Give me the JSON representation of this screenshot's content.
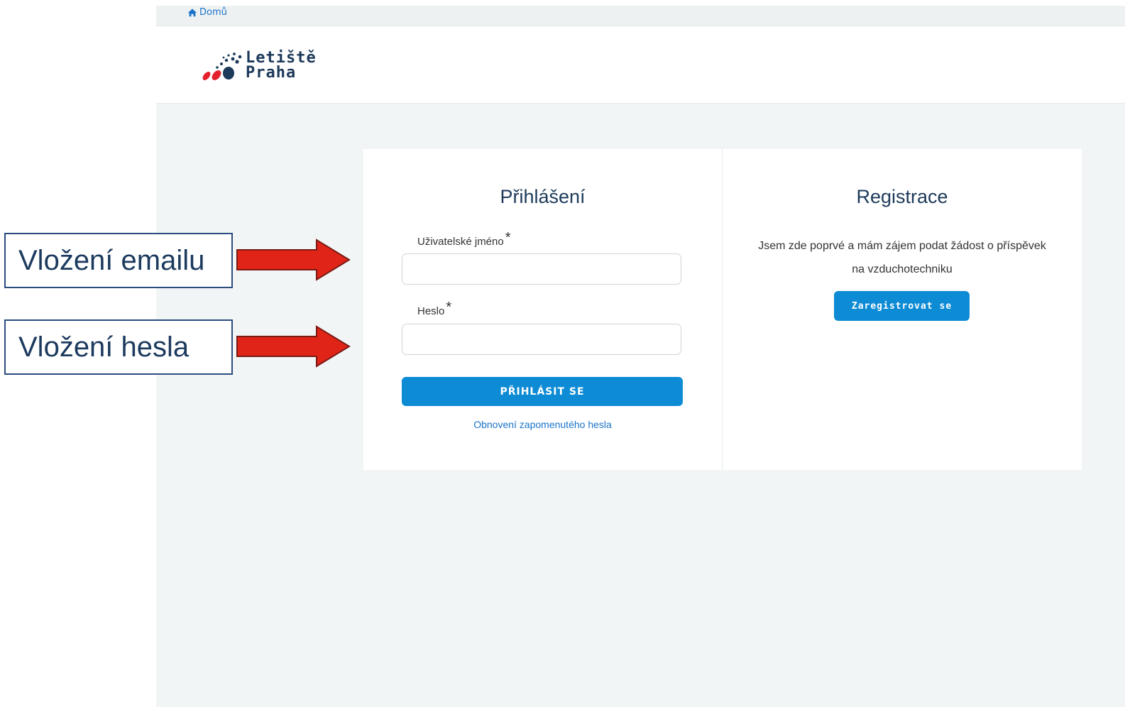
{
  "breadcrumb": {
    "home_label": "Domů"
  },
  "header": {
    "logo_line1": "Letiště",
    "logo_line2": "Praha"
  },
  "login": {
    "title": "Přihlášení",
    "username_label": "Uživatelské jméno",
    "password_label": "Heslo",
    "required_marker": "*",
    "username_value": "",
    "password_value": "",
    "submit_label": "PŘIHLÁSIT SE",
    "forgot_link": "Obnovení zapomenutého hesla"
  },
  "registration": {
    "title": "Registrace",
    "description": "Jsem zde poprvé a mám zájem podat žádost o příspěvek na vzduchotechniku",
    "button_label": "Zaregistrovat se"
  },
  "annotations": {
    "email_callout": "Vložení emailu",
    "password_callout": "Vložení hesla"
  },
  "colors": {
    "primary_button": "#0d8bd5",
    "link": "#1a73c9",
    "title": "#1d3a5a",
    "arrow": "#e02518",
    "logo_red": "#e4222e",
    "logo_navy": "#1d3a5a"
  },
  "icons": {
    "breadcrumb_home": "home-icon",
    "logo": "letiste-praha-logo-icon",
    "annotation_arrow": "right-arrow-icon"
  }
}
